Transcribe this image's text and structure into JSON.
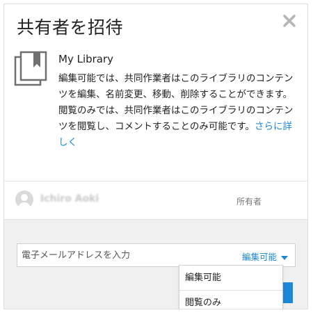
{
  "dialog": {
    "title": "共有者を招待",
    "close_icon": "close-icon"
  },
  "library": {
    "icon": "library-book-icon",
    "name": "My Library",
    "description_edit": "編集可能では、共同作業者はこのライブラリのコンテンツを編集、名前変更、移動、削除することができます。",
    "description_view": "閲覧のみでは、共同作業者はこのライブラリのコンテンツを閲覧し、コメントすることのみ可能です。",
    "learn_more": "さらに詳しく"
  },
  "owner": {
    "avatar_icon": "user-avatar-icon",
    "name": "Ichiro Aoki",
    "role": "所有者"
  },
  "invite": {
    "email_placeholder": "電子メールアドレスを入力",
    "permission_selected": "編集可能",
    "permission_options": [
      "編集可能",
      "閲覧のみ"
    ]
  },
  "colors": {
    "accent": "#1a86d0",
    "button": "#1e88d8",
    "footer_bg": "#f0f0f0"
  }
}
